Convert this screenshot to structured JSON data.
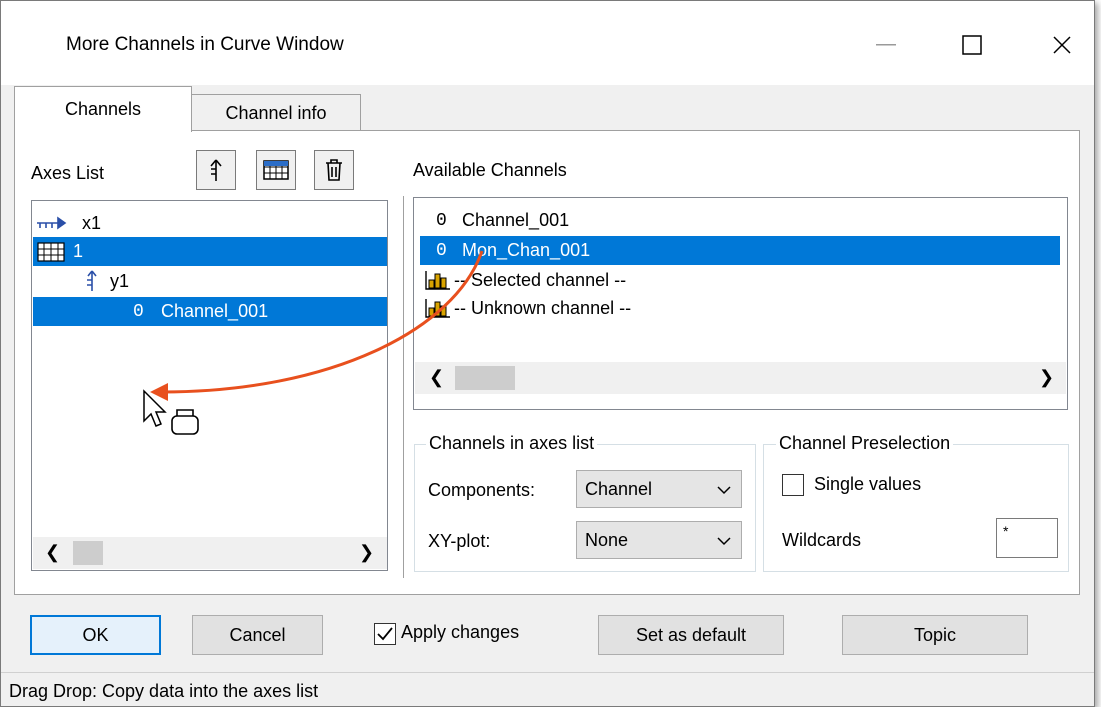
{
  "window": {
    "title": "More Channels in Curve Window"
  },
  "tabs": [
    {
      "label": "Channels",
      "active": true
    },
    {
      "label": "Channel info",
      "active": false
    }
  ],
  "axes_list": {
    "label": "Axes List",
    "toolbar": [
      "axis-icon",
      "grid-icon",
      "trash-icon"
    ],
    "items": [
      {
        "text": "x1",
        "icon": "x-axis-icon",
        "selected": false
      },
      {
        "text": "1",
        "icon": "grid-icon",
        "selected": true
      },
      {
        "text": "y1",
        "icon": "y-axis-icon",
        "selected": false
      },
      {
        "prefix": "0",
        "text": "Channel_001",
        "selected": true
      }
    ]
  },
  "available_channels": {
    "label": "Available Channels",
    "items": [
      {
        "prefix": "0",
        "text": "Channel_001",
        "selected": false
      },
      {
        "prefix": "0",
        "text": "Mon_Chan_001",
        "selected": true
      },
      {
        "text": "-- Selected channel --",
        "icon": "histogram-icon",
        "selected": false
      },
      {
        "text": "-- Unknown channel --",
        "icon": "histogram-icon",
        "selected": false
      }
    ]
  },
  "channels_in_axes_list": {
    "legend": "Channels in axes list",
    "components_label": "Components:",
    "components_value": "Channel",
    "xy_label": "XY-plot:",
    "xy_value": "None"
  },
  "channel_preselection": {
    "legend": "Channel Preselection",
    "single_values_label": "Single values",
    "single_values_checked": false,
    "wildcards_label": "Wildcards",
    "wildcards_value": "*"
  },
  "buttons": {
    "ok": "OK",
    "cancel": "Cancel",
    "apply_changes": "Apply changes",
    "apply_checked": true,
    "set_default": "Set as default",
    "topic": "Topic"
  },
  "status": "Drag  Drop: Copy data into the axes list",
  "colors": {
    "selection": "#0078d7",
    "drag_arrow": "#e8501e"
  }
}
